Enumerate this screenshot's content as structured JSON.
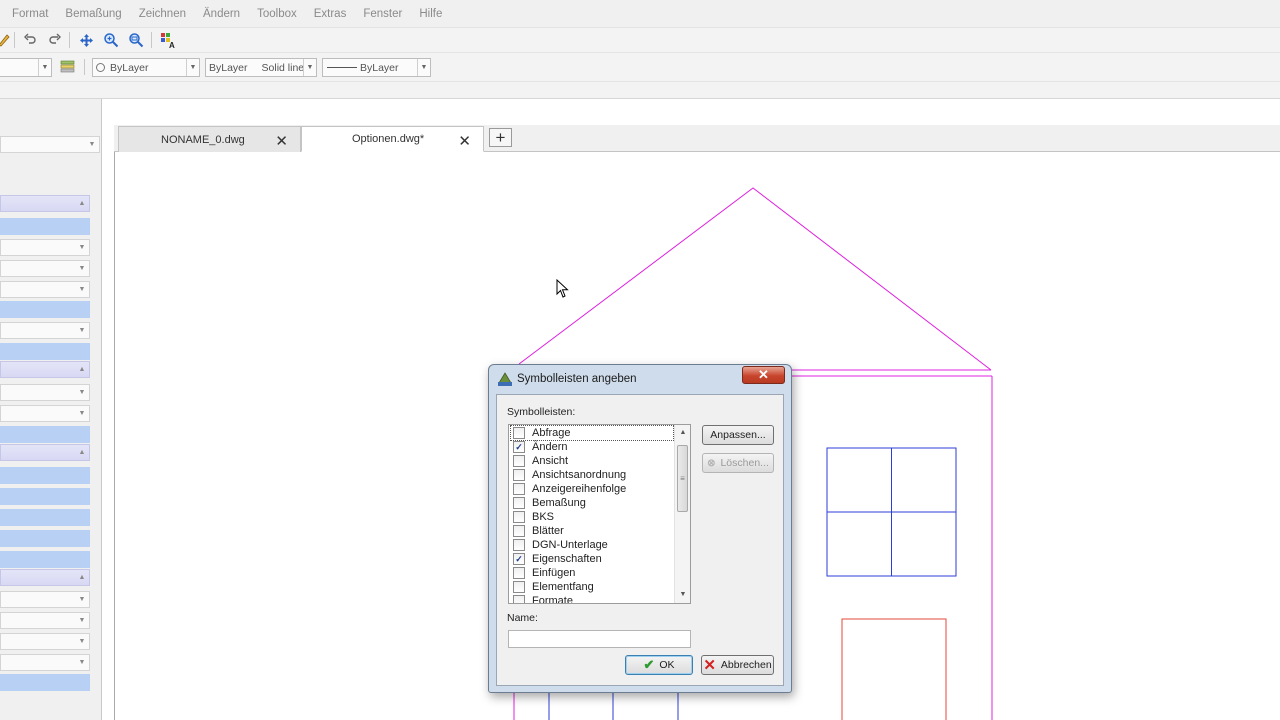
{
  "menubar": {
    "items": [
      "Format",
      "Bemaßung",
      "Zeichnen",
      "Ändern",
      "Toolbox",
      "Extras",
      "Fenster",
      "Hilfe"
    ]
  },
  "toolbar1": {
    "icons": [
      "pencil-icon",
      "undo-icon",
      "redo-icon",
      "pan-icon",
      "zoom-realtime-icon",
      "zoom-window-icon",
      "layer-palette-icon"
    ]
  },
  "toolbar2": {
    "layer_combo": "",
    "color_combo": "ByLayer",
    "linetype_combo": "ByLayer",
    "linetype_name": "Solid line",
    "lineweight_combo": "ByLayer"
  },
  "tabs": [
    {
      "label": "NONAME_0.dwg",
      "active": false
    },
    {
      "label": "Optionen.dwg*",
      "active": true
    }
  ],
  "dialog": {
    "title": "Symbolleisten angeben",
    "list_label": "Symbolleisten:",
    "items": [
      {
        "label": "Abfrage",
        "checked": false
      },
      {
        "label": "Ändern",
        "checked": true
      },
      {
        "label": "Ansicht",
        "checked": false
      },
      {
        "label": "Ansichtsanordnung",
        "checked": false
      },
      {
        "label": "Anzeigereihenfolge",
        "checked": false
      },
      {
        "label": "Bemaßung",
        "checked": false
      },
      {
        "label": "BKS",
        "checked": false
      },
      {
        "label": "Blätter",
        "checked": false
      },
      {
        "label": "DGN-Unterlage",
        "checked": false
      },
      {
        "label": "Eigenschaften",
        "checked": true
      },
      {
        "label": "Einfügen",
        "checked": false
      },
      {
        "label": "Elementfang",
        "checked": false
      },
      {
        "label": "Formate",
        "checked": false
      }
    ],
    "customize_button": "Anpassen...",
    "delete_button": "Löschen...",
    "name_label": "Name:",
    "name_value": "",
    "ok_button": "OK",
    "cancel_button": "Abbrechen"
  },
  "colors": {
    "roof_line": "#e020e0",
    "wall_line": "#e020e0",
    "window_line": "#2c3ed8",
    "door_line": "#e34a3a",
    "panel_value": "#b8d0f4"
  }
}
